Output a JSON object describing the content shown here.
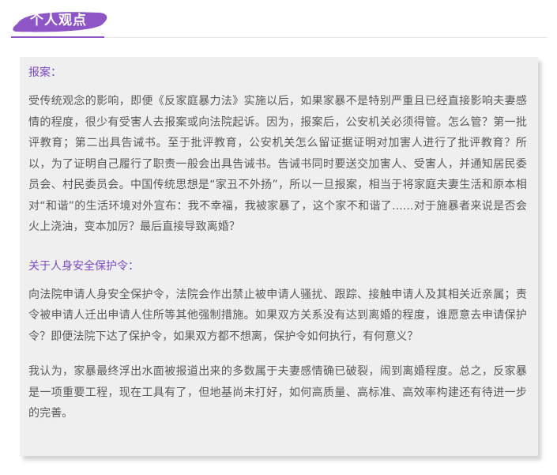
{
  "header": {
    "tag_label": "个人观点",
    "accent_color": "#8e55c6"
  },
  "card": {
    "section1_heading": "报案：",
    "section1_body": "受传统观念的影响，即便《反家庭暴力法》实施以后，如果家暴不是特别严重且已经直接影响夫妻感情的程度，很少有受害人去报案或向法院起诉。因为，报案后，公安机关必须得管。怎么管？第一批评教育；第二出具告诫书。至于批评教育，公安机关怎么留证据证明对加害人进行了批评教育？所以，为了证明自己履行了职责一般会出具告诫书。告诫书同时要送交加害人、受害人，并通知居民委员会、村民委员会。中国传统思想是“家丑不外扬”，所以一旦报案，相当于将家庭夫妻生活和原本相对“和谐”的生活环境对外宣布：我不幸福，我被家暴了，这个家不和谐了......对于施暴者来说是否会火上浇油，变本加厉？最后直接导致离婚？",
    "section2_heading": "关于人身安全保护令：",
    "section2_body": "向法院申请人身安全保护令，法院会作出禁止被申请人骚扰、跟踪、接触申请人及其相关近亲属；责令被申请人迁出申请人住所等其他强制措施。如果双方关系没有达到离婚的程度，谁愿意去申请保护令？即便法院下达了保护令，如果双方都不想离，保护令如何执行，有何意义？",
    "conclusion_body": "我认为，家暴最终浮出水面被报道出来的多数属于夫妻感情确已破裂，闹到离婚程度。总之，反家暴是一项重要工程，现在工具有了，但地基尚未打好，如何高质量、高标准、高效率构建还有待进一步的完善。"
  }
}
